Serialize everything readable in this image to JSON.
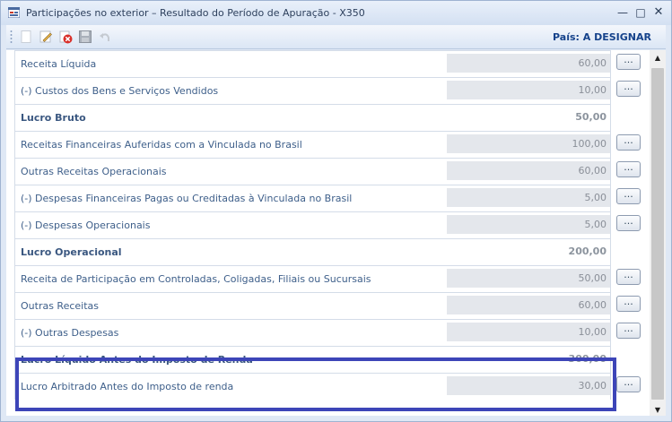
{
  "window": {
    "title": "Participações no exterior – Resultado do Período de Apuração - X350",
    "minimize_glyph": "—",
    "maximize_glyph": "□",
    "close_glyph": "✕"
  },
  "toolbar": {
    "icons": [
      "new-icon",
      "edit-icon",
      "delete-icon",
      "save-icon",
      "undo-icon"
    ],
    "country_label": "País: A DESIGNAR"
  },
  "rows": [
    {
      "label": "Receita Líquida",
      "value": "60,00",
      "bold": false,
      "has_button": true
    },
    {
      "label": "(-) Custos dos Bens e Serviços Vendidos",
      "value": "10,00",
      "bold": false,
      "has_button": true
    },
    {
      "label": "Lucro Bruto",
      "value": "50,00",
      "bold": true,
      "has_button": false
    },
    {
      "label": "Receitas Financeiras Auferidas com a Vinculada no Brasil",
      "value": "100,00",
      "bold": false,
      "has_button": true
    },
    {
      "label": "Outras Receitas Operacionais",
      "value": "60,00",
      "bold": false,
      "has_button": true
    },
    {
      "label": "(-) Despesas Financeiras Pagas ou Creditadas à Vinculada no Brasil",
      "value": "5,00",
      "bold": false,
      "has_button": true
    },
    {
      "label": "(-) Despesas Operacionais",
      "value": "5,00",
      "bold": false,
      "has_button": true
    },
    {
      "label": "Lucro Operacional",
      "value": "200,00",
      "bold": true,
      "has_button": false
    },
    {
      "label": "Receita de Participação em Controladas, Coligadas, Filiais ou Sucursais",
      "value": "50,00",
      "bold": false,
      "has_button": true
    },
    {
      "label": "Outras Receitas",
      "value": "60,00",
      "bold": false,
      "has_button": true
    },
    {
      "label": "(-) Outras Despesas",
      "value": "10,00",
      "bold": false,
      "has_button": true
    },
    {
      "label": "Lucro Líquido Antes do Imposto de Renda",
      "value": "300,00",
      "bold": true,
      "has_button": false
    },
    {
      "label": "Lucro Arbitrado Antes do Imposto de renda",
      "value": "30,00",
      "bold": false,
      "has_button": true
    }
  ],
  "button_label": "...",
  "scrollbar": {
    "up_glyph": "▲",
    "down_glyph": "▼"
  },
  "colors": {
    "highlight_border": "#3d45b8",
    "title_text": "#15428b",
    "label_text": "#3e5f8a"
  }
}
